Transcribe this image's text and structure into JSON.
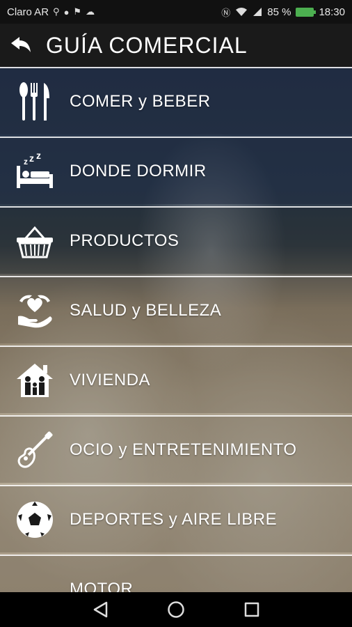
{
  "status_bar": {
    "carrier": "Claro AR",
    "battery_percent": "85 %",
    "time": "18:30",
    "icons": [
      "usb-icon",
      "chat-icon",
      "flag-icon",
      "cloud-icon",
      "nfc-icon",
      "wifi-icon",
      "signal-icon",
      "battery-icon"
    ]
  },
  "app_bar": {
    "title": "GUÍA COMERCIAL",
    "back_icon": "back-arrow-icon"
  },
  "menu": {
    "items": [
      {
        "label": "COMER y BEBER",
        "icon": "cutlery-icon"
      },
      {
        "label": "DONDE DORMIR",
        "icon": "bed-icon"
      },
      {
        "label": "PRODUCTOS",
        "icon": "basket-icon"
      },
      {
        "label": "SALUD y BELLEZA",
        "icon": "heart-hands-icon"
      },
      {
        "label": "VIVIENDA",
        "icon": "house-family-icon"
      },
      {
        "label": "OCIO y ENTRETENIMIENTO",
        "icon": "guitar-icon"
      },
      {
        "label": "DEPORTES y AIRE LIBRE",
        "icon": "soccer-ball-icon"
      },
      {
        "label": "MOTOR",
        "icon": "car-icon"
      }
    ]
  },
  "nav_bar": {
    "buttons": [
      "back-triangle-icon",
      "home-circle-icon",
      "recents-square-icon"
    ]
  },
  "colors": {
    "status_bar_bg": "#111111",
    "app_bar_bg": "#1a1a1a",
    "battery": "#4caf50",
    "divider": "#ffffff"
  }
}
